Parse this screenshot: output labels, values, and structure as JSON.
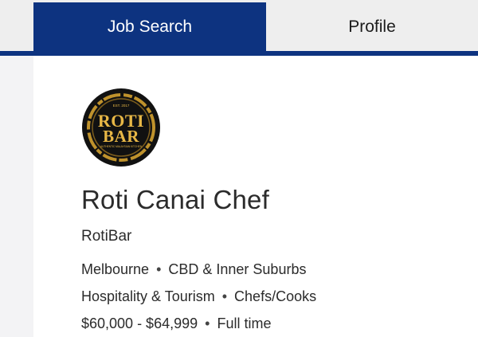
{
  "nav": {
    "tabs": [
      {
        "label": "Job Search",
        "active": true
      },
      {
        "label": "Profile",
        "active": false
      }
    ],
    "accent_color": "#0d3380"
  },
  "job": {
    "logo": {
      "icon": "rotibar-logo",
      "top_text": "EST. 2017",
      "word1": "ROTI",
      "word2": "BAR",
      "tagline": "AUTHENTIC MALAYSIAN KITCHEN",
      "colors": {
        "background": "#111111",
        "ring": "#c99a2e",
        "text": "#e7b746"
      }
    },
    "title": "Roti Canai Chef",
    "company": "RotiBar",
    "location": "Melbourne",
    "area": "CBD & Inner Suburbs",
    "category": "Hospitality & Tourism",
    "subcategory": "Chefs/Cooks",
    "salary": "$60,000 - $64,999",
    "work_type": "Full time",
    "separator": "•"
  }
}
